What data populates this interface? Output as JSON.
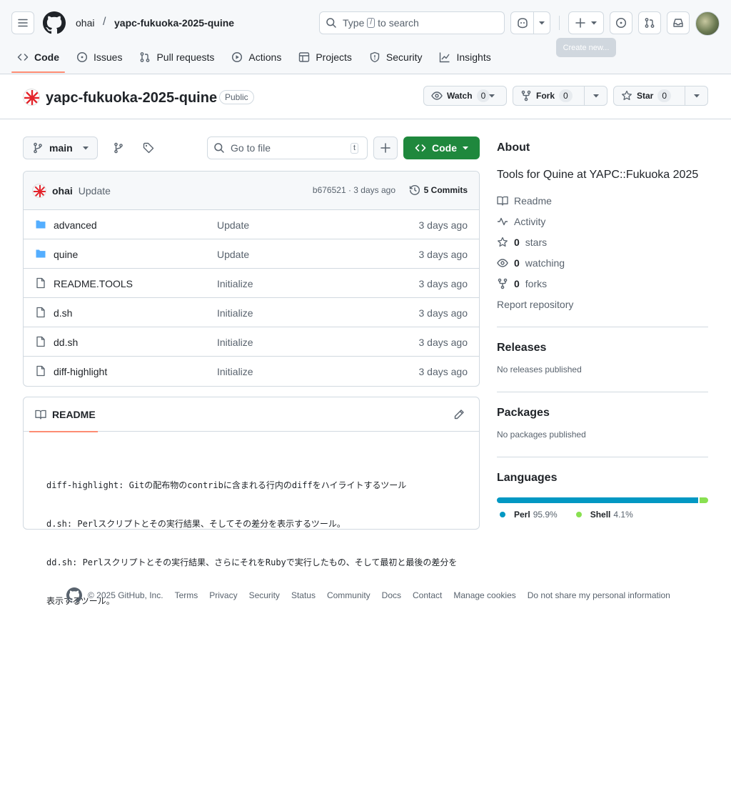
{
  "header": {
    "owner": "ohai",
    "separator": "/",
    "repo": "yapc-fukuoka-2025-quine",
    "search_prefix": "Type",
    "search_key": "/",
    "search_suffix": "to search",
    "tooltip": "Create new..."
  },
  "nav": {
    "code": "Code",
    "issues": "Issues",
    "pulls": "Pull requests",
    "actions": "Actions",
    "projects": "Projects",
    "security": "Security",
    "insights": "Insights"
  },
  "repo": {
    "title": "yapc-fukuoka-2025-quine",
    "visibility": "Public",
    "watch_label": "Watch",
    "watch_count": "0",
    "fork_label": "Fork",
    "fork_count": "0",
    "star_label": "Star",
    "star_count": "0"
  },
  "toolbar": {
    "branch": "main",
    "goto_placeholder": "Go to file",
    "goto_key": "t",
    "code_button": "Code"
  },
  "commit": {
    "author": "ohai",
    "message": "Update",
    "hash_time": "b676521 · 3 days ago",
    "commits": "5 Commits"
  },
  "files": [
    {
      "name": "advanced",
      "type": "dir",
      "message": "Update",
      "date": "3 days ago"
    },
    {
      "name": "quine",
      "type": "dir",
      "message": "Update",
      "date": "3 days ago"
    },
    {
      "name": "README.TOOLS",
      "type": "file",
      "message": "Initialize",
      "date": "3 days ago"
    },
    {
      "name": "d.sh",
      "type": "file",
      "message": "Initialize",
      "date": "3 days ago"
    },
    {
      "name": "dd.sh",
      "type": "file",
      "message": "Initialize",
      "date": "3 days ago"
    },
    {
      "name": "diff-highlight",
      "type": "file",
      "message": "Initialize",
      "date": "3 days ago"
    }
  ],
  "readme": {
    "tab": "README",
    "lines": [
      "diff-highlight: Gitの配布物のcontribに含まれる行内のdiffをハイライトするツール",
      "d.sh: Perlスクリプトとその実行結果、そしてその差分を表示するツール。",
      "dd.sh: Perlスクリプトとその実行結果、さらにそれをRubyで実行したもの、そして最初と最後の差分を",
      "表示するツール。"
    ]
  },
  "about": {
    "heading": "About",
    "description": "Tools for Quine at YAPC::Fukuoka 2025",
    "readme": "Readme",
    "activity": "Activity",
    "stars_count": "0",
    "stars_label": "stars",
    "watching_count": "0",
    "watching_label": "watching",
    "forks_count": "0",
    "forks_label": "forks",
    "report": "Report repository"
  },
  "releases": {
    "heading": "Releases",
    "empty": "No releases published"
  },
  "packages": {
    "heading": "Packages",
    "empty": "No packages published"
  },
  "languages": {
    "heading": "Languages",
    "items": [
      {
        "name": "Perl",
        "percent": "95.9%",
        "value": 95.9,
        "color": "#0298c3"
      },
      {
        "name": "Shell",
        "percent": "4.1%",
        "value": 4.1,
        "color": "#89e051"
      }
    ]
  },
  "footer": {
    "copyright": "© 2025 GitHub, Inc.",
    "links": [
      "Terms",
      "Privacy",
      "Security",
      "Status",
      "Community",
      "Docs",
      "Contact",
      "Manage cookies",
      "Do not share my personal information"
    ]
  },
  "colors": {
    "accent_green": "#1f883d",
    "nav_underline": "#fd8c73",
    "folder_blue": "#54aeff"
  }
}
